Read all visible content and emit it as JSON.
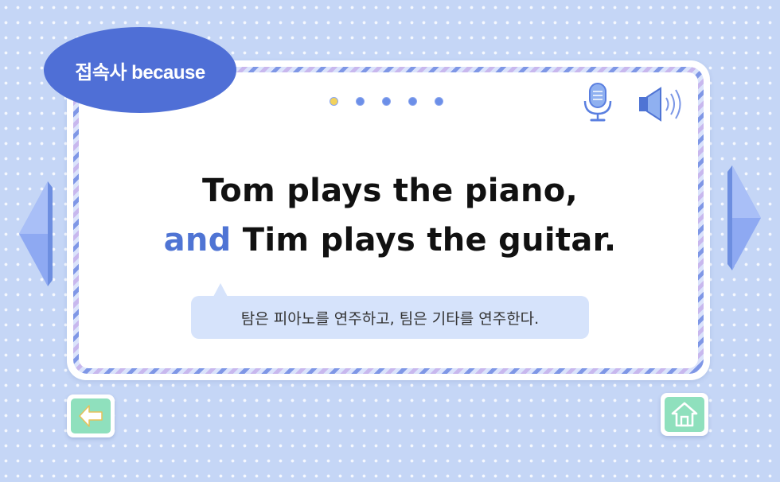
{
  "badge": {
    "label": "접속사 because"
  },
  "progress": {
    "total": 5,
    "current": 1
  },
  "icons": {
    "mic": "microphone-icon",
    "speaker": "speaker-icon",
    "prev": "chevron-left-icon",
    "next": "chevron-right-icon",
    "back": "arrow-left-icon",
    "home": "home-icon"
  },
  "sentence": {
    "line1": "Tom plays the piano,",
    "conjunction": "and",
    "line2_rest": " Tim plays the guitar."
  },
  "translation": {
    "text": "탐은 피아노를 연주하고, 팀은 기타를 연주한다."
  },
  "colors": {
    "background": "#c5d6f6",
    "accent": "#4f6fd6",
    "conjunction": "#4f74d4",
    "button_green": "#8fe0bd",
    "active_dot": "#f2d25c"
  }
}
